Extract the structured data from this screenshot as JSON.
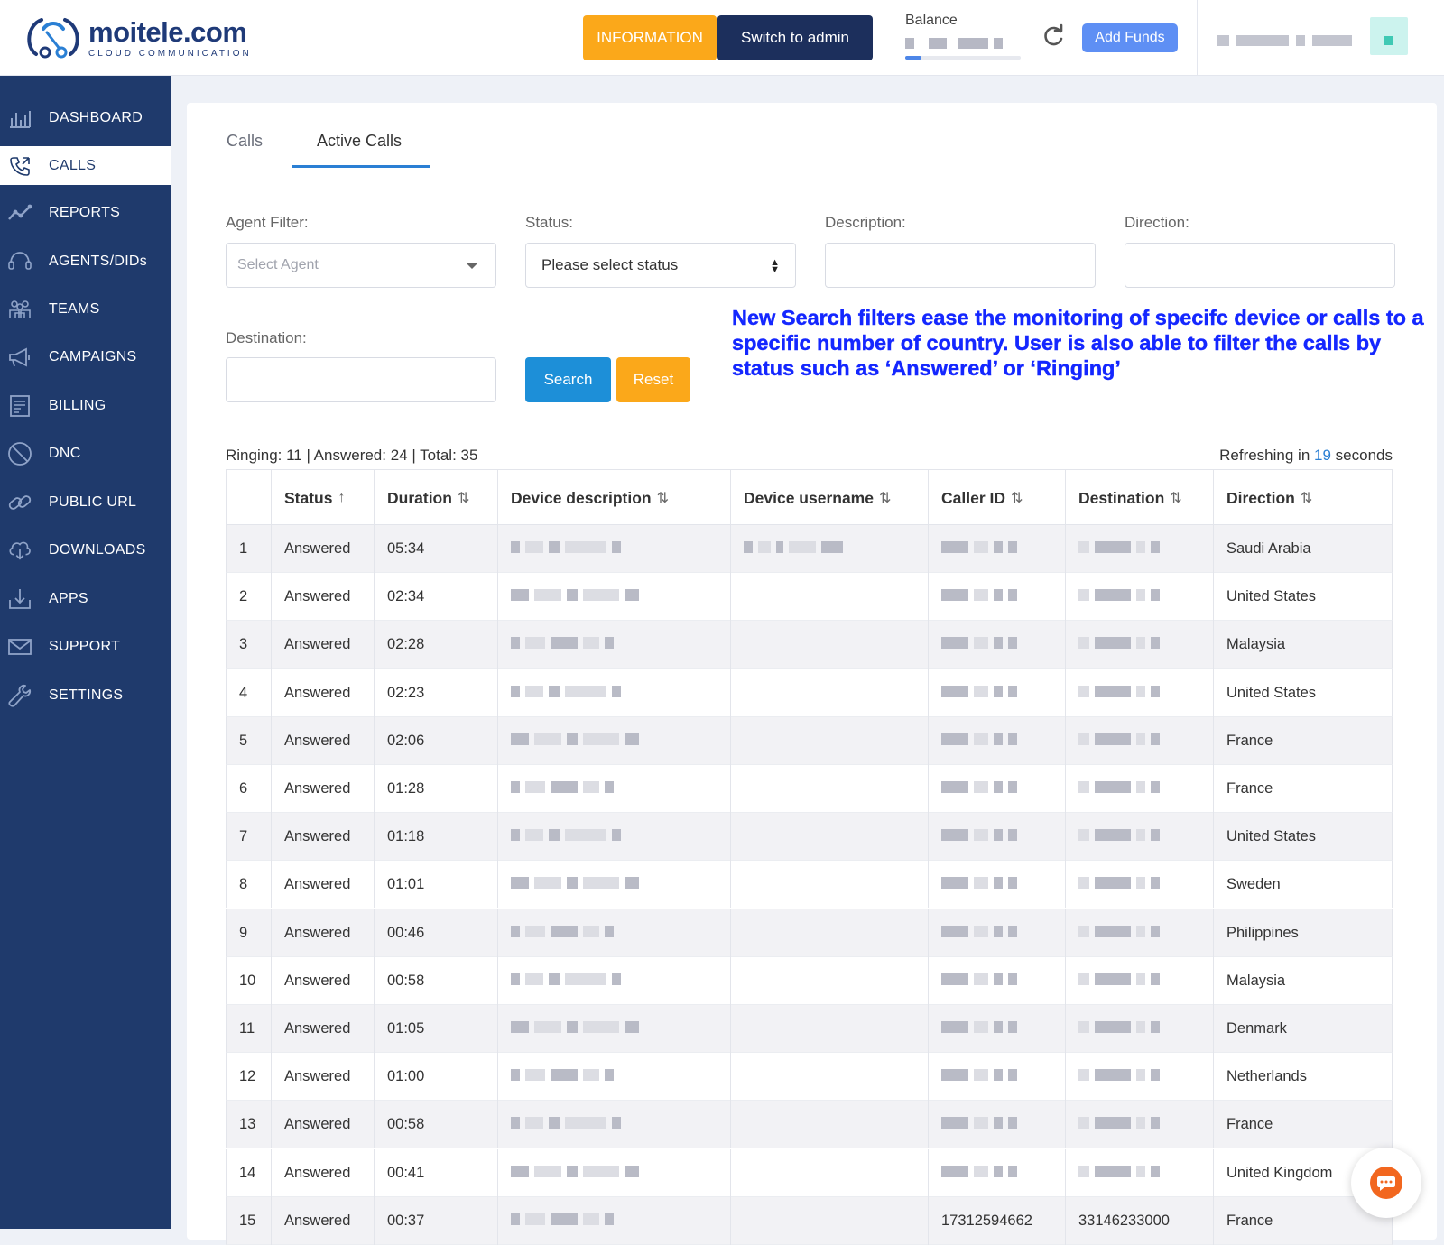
{
  "header": {
    "logo_name": "moitele.com",
    "logo_tagline": "CLOUD COMMUNICATION",
    "information_label": "INFORMATION",
    "switch_admin_label": "Switch to admin",
    "balance_label": "Balance",
    "add_funds_label": "Add Funds",
    "accent_orange": "#fba81a",
    "accent_navy": "#1c2f5c"
  },
  "sidebar": {
    "items": [
      {
        "label": "DASHBOARD",
        "icon": "dashboard-chart-icon"
      },
      {
        "label": "CALLS",
        "icon": "phone-calls-icon",
        "active": true
      },
      {
        "label": "REPORTS",
        "icon": "trend-line-icon"
      },
      {
        "label": "AGENTS/DIDs",
        "icon": "headset-icon"
      },
      {
        "label": "TEAMS",
        "icon": "team-icon"
      },
      {
        "label": "CAMPAIGNS",
        "icon": "megaphone-icon"
      },
      {
        "label": "BILLING",
        "icon": "invoice-icon"
      },
      {
        "label": "DNC",
        "icon": "no-entry-icon"
      },
      {
        "label": "PUBLIC URL",
        "icon": "link-icon"
      },
      {
        "label": "DOWNLOADS",
        "icon": "cloud-download-icon"
      },
      {
        "label": "APPS",
        "icon": "download-tray-icon"
      },
      {
        "label": "SUPPORT",
        "icon": "envelope-icon"
      },
      {
        "label": "SETTINGS",
        "icon": "wrench-icon"
      }
    ]
  },
  "tabs": [
    {
      "label": "Calls"
    },
    {
      "label": "Active Calls",
      "active": true
    }
  ],
  "filters": {
    "agent_label": "Agent Filter:",
    "agent_placeholder": "Select Agent",
    "status_label": "Status:",
    "status_value": "Please select status",
    "description_label": "Description:",
    "direction_label": "Direction:",
    "destination_label": "Destination:",
    "search_label": "Search",
    "reset_label": "Reset"
  },
  "annotation": "New Search filters ease the monitoring of specifc device or calls to a specific number of country. User is also able to filter the calls by status such as ‘Answered’ or ‘Ringing’",
  "summary": {
    "counts": "Ringing: 11 | Answered: 24 | Total: 35",
    "refresh_prefix": "Refreshing in",
    "refresh_seconds": "19",
    "refresh_suffix": "seconds"
  },
  "table": {
    "columns": [
      "",
      "Status",
      "Duration",
      "Device description",
      "Device username",
      "Caller ID",
      "Destination",
      "Direction"
    ],
    "sort_icons": [
      "",
      "↑",
      "⇅",
      "⇅",
      "⇅",
      "⇅",
      "⇅",
      "⇅"
    ],
    "rows": [
      {
        "n": "1",
        "status": "Answered",
        "duration": "05:34",
        "caller_id": "",
        "destination": "",
        "direction": "Saudi Arabia"
      },
      {
        "n": "2",
        "status": "Answered",
        "duration": "02:34",
        "caller_id": "",
        "destination": "",
        "direction": "United States"
      },
      {
        "n": "3",
        "status": "Answered",
        "duration": "02:28",
        "caller_id": "",
        "destination": "",
        "direction": "Malaysia"
      },
      {
        "n": "4",
        "status": "Answered",
        "duration": "02:23",
        "caller_id": "",
        "destination": "",
        "direction": "United States"
      },
      {
        "n": "5",
        "status": "Answered",
        "duration": "02:06",
        "caller_id": "",
        "destination": "",
        "direction": "France"
      },
      {
        "n": "6",
        "status": "Answered",
        "duration": "01:28",
        "caller_id": "",
        "destination": "",
        "direction": "France"
      },
      {
        "n": "7",
        "status": "Answered",
        "duration": "01:18",
        "caller_id": "",
        "destination": "",
        "direction": "United States"
      },
      {
        "n": "8",
        "status": "Answered",
        "duration": "01:01",
        "caller_id": "",
        "destination": "",
        "direction": "Sweden"
      },
      {
        "n": "9",
        "status": "Answered",
        "duration": "00:46",
        "caller_id": "",
        "destination": "",
        "direction": "Philippines"
      },
      {
        "n": "10",
        "status": "Answered",
        "duration": "00:58",
        "caller_id": "",
        "destination": "",
        "direction": "Malaysia"
      },
      {
        "n": "11",
        "status": "Answered",
        "duration": "01:05",
        "caller_id": "",
        "destination": "",
        "direction": "Denmark"
      },
      {
        "n": "12",
        "status": "Answered",
        "duration": "01:00",
        "caller_id": "",
        "destination": "",
        "direction": "Netherlands"
      },
      {
        "n": "13",
        "status": "Answered",
        "duration": "00:58",
        "caller_id": "",
        "destination": "",
        "direction": "France"
      },
      {
        "n": "14",
        "status": "Answered",
        "duration": "00:41",
        "caller_id": "",
        "destination": "",
        "direction": "United Kingdom"
      },
      {
        "n": "15",
        "status": "Answered",
        "duration": "00:37",
        "caller_id": "17312594662",
        "destination": "33146233000",
        "direction": "France"
      }
    ]
  },
  "chat": {
    "icon": "chat-bubble-icon"
  }
}
